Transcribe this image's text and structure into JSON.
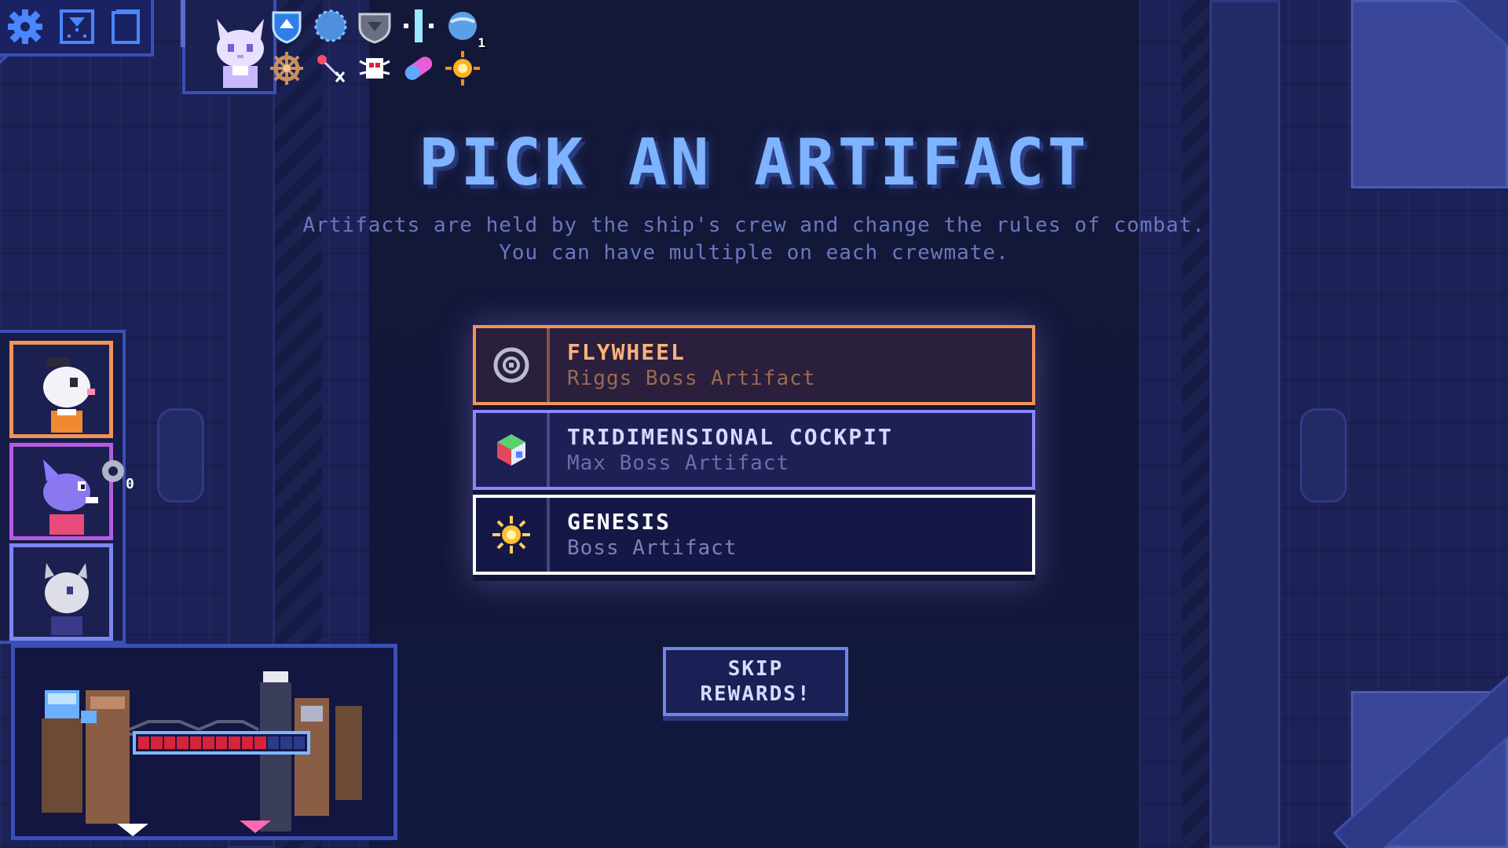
{
  "screen": {
    "title": "PICK AN ARTIFACT",
    "description_line1": "Artifacts are held by the ship's crew and change the rules of combat.",
    "description_line2": "You can have multiple on each crewmate."
  },
  "toolbar": {
    "icons": [
      "gear-icon",
      "deck-icon",
      "card-icon"
    ]
  },
  "owned_artifacts": {
    "badge_count": "1",
    "icons": [
      "shield-up-icon",
      "blue-orb-icon",
      "grey-shield-icon",
      "crystal-bar-icon",
      "globe-icon",
      "wheel-icon",
      "spark-icon",
      "bug-icon",
      "pill-icon",
      "sun-icon"
    ]
  },
  "artifact_choices": [
    {
      "name": "FLYWHEEL",
      "subtitle": "Riggs Boss Artifact",
      "icon": "flywheel-icon",
      "accent": "#f0935a"
    },
    {
      "name": "TRIDIMENSIONAL COCKPIT",
      "subtitle": "Max Boss Artifact",
      "icon": "cube-icon",
      "accent": "#8c86ff"
    },
    {
      "name": "GENESIS",
      "subtitle": "Boss Artifact",
      "icon": "sun-icon",
      "accent": "#ffffff"
    }
  ],
  "skip_button": {
    "line1": "SKIP",
    "line2": "REWARDS!"
  },
  "crew": {
    "members": [
      "crew-portrait-riggs",
      "crew-portrait-max",
      "crew-portrait-isaac"
    ],
    "badge_count": "0"
  },
  "ship": {
    "hull_filled": 10,
    "hull_total": 13
  },
  "colors": {
    "title": "#7eb3ff",
    "riggs_accent": "#f0935a",
    "max_accent": "#b45ce0",
    "isaac_accent": "#7c86f0",
    "hull_red": "#d8243a"
  }
}
